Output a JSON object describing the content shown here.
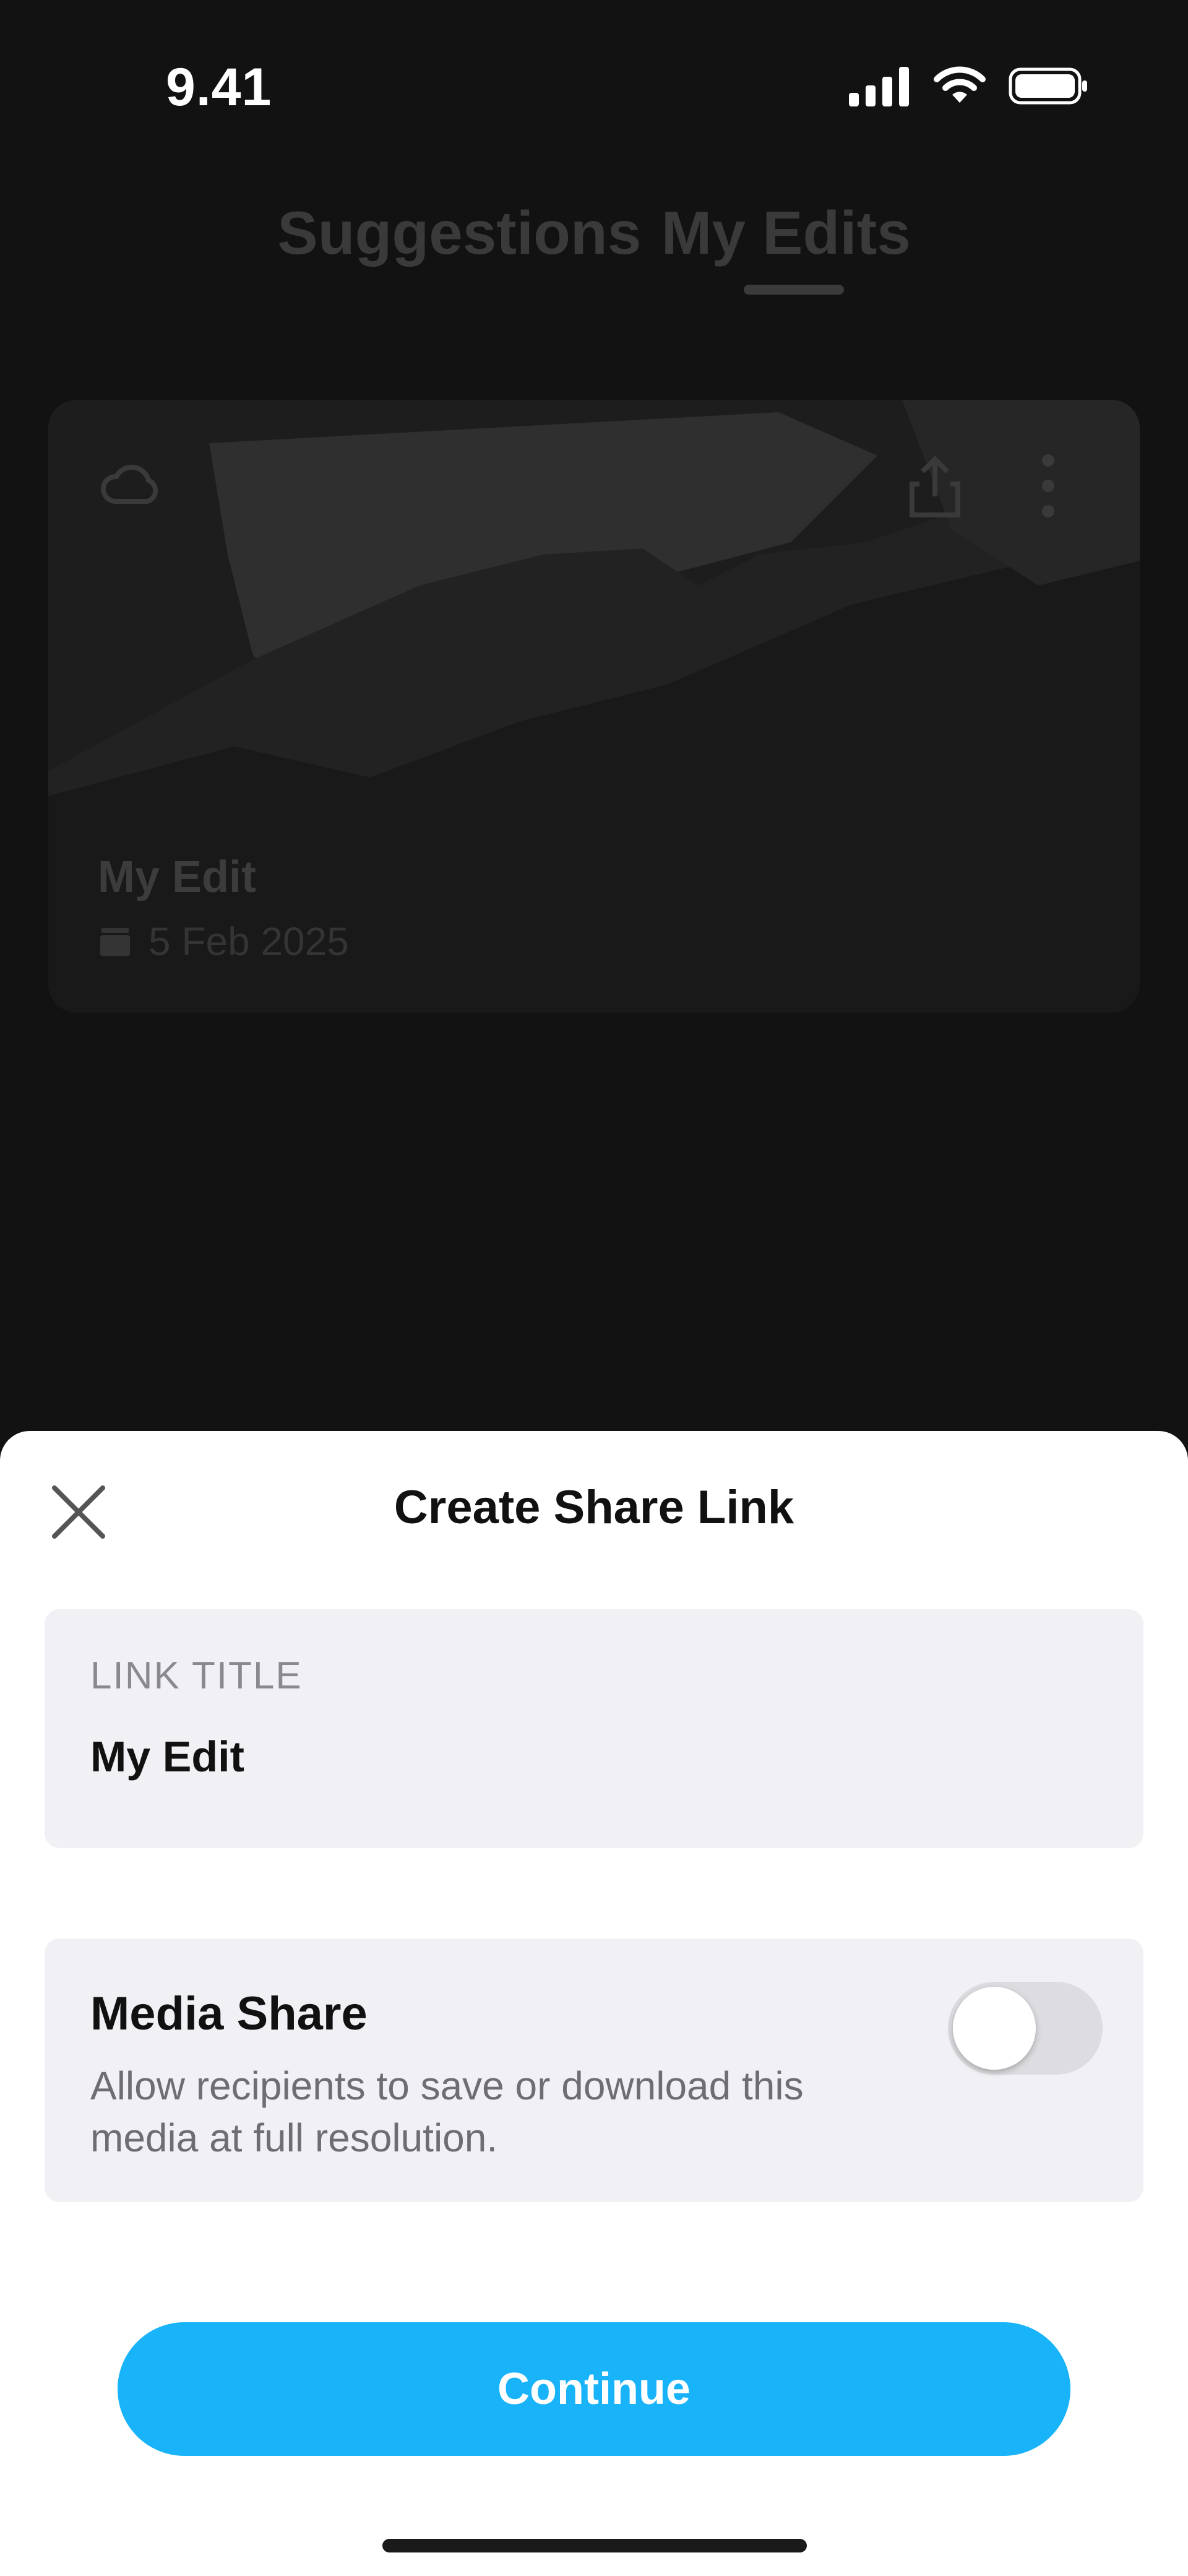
{
  "status_bar": {
    "time": "9.41"
  },
  "tabs": [
    {
      "label": "Suggestions",
      "selected": false
    },
    {
      "label": "My Edits",
      "selected": true
    }
  ],
  "card": {
    "title": "My Edit",
    "date": "5 Feb 2025",
    "icons": [
      "cloud-icon",
      "share-icon",
      "more-icon",
      "clapperboard-icon"
    ]
  },
  "sheet": {
    "title": "Create Share Link",
    "link_title_label": "LINK TITLE",
    "link_title_value": "My Edit",
    "media_share_title": "Media Share",
    "media_share_desc": "Allow recipients to save or download this media at full resolution.",
    "media_share_enabled": false,
    "continue_label": "Continue"
  },
  "colors": {
    "accent": "#18b3f9",
    "sheet_bg": "#ffffff",
    "field_bg": "#f1f1f5",
    "overlay_bg": "#121212"
  }
}
